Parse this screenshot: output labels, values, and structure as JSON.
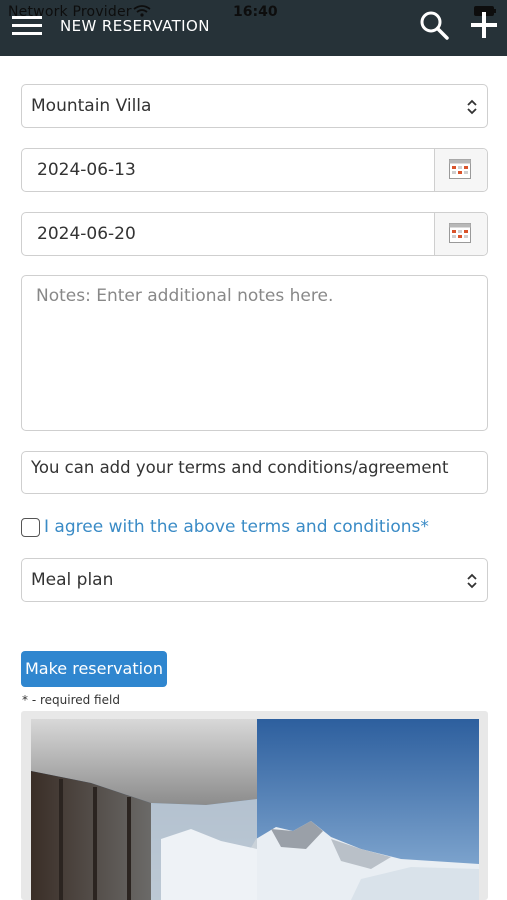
{
  "status_bar": {
    "provider": "Network Provider",
    "time": "16:40"
  },
  "header": {
    "title": "NEW RESERVATION",
    "icons": [
      "menu-icon",
      "search-icon",
      "add-icon"
    ]
  },
  "form": {
    "property_select": {
      "value": "Mountain Villa"
    },
    "start_date": {
      "value": "2024-06-13"
    },
    "end_date": {
      "value": "2024-06-20"
    },
    "notes": {
      "placeholder": "Notes: Enter additional notes here."
    },
    "terms_text": "You can add your terms and conditions/agreement",
    "agree_label": "I agree with the above terms and conditions*",
    "meal_plan_select": {
      "value": "Meal plan"
    },
    "submit_label": "Make reservation",
    "required_note": "* - required field"
  },
  "colors": {
    "header_bg": "#263238",
    "accent": "#2f86cf",
    "link": "#3a8bc6"
  }
}
